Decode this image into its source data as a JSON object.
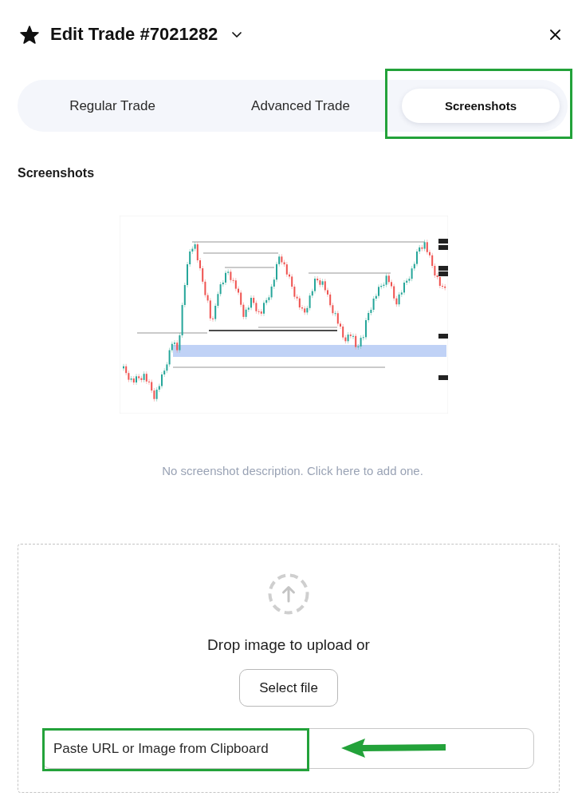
{
  "header": {
    "title": "Edit Trade #7021282",
    "starred": true
  },
  "tabs": [
    {
      "label": "Regular Trade",
      "selected": false,
      "highlighted": false
    },
    {
      "label": "Advanced Trade",
      "selected": false,
      "highlighted": false
    },
    {
      "label": "Screenshots",
      "selected": true,
      "highlighted": true
    }
  ],
  "section": {
    "title": "Screenshots",
    "description_prompt": "No screenshot description. Click here to add one."
  },
  "upload": {
    "prompt": "Drop image to upload or",
    "button": "Select file",
    "paste_field": {
      "placeholder": "Paste URL or Image from Clipboard",
      "highlighted": true,
      "arrow": true
    }
  }
}
